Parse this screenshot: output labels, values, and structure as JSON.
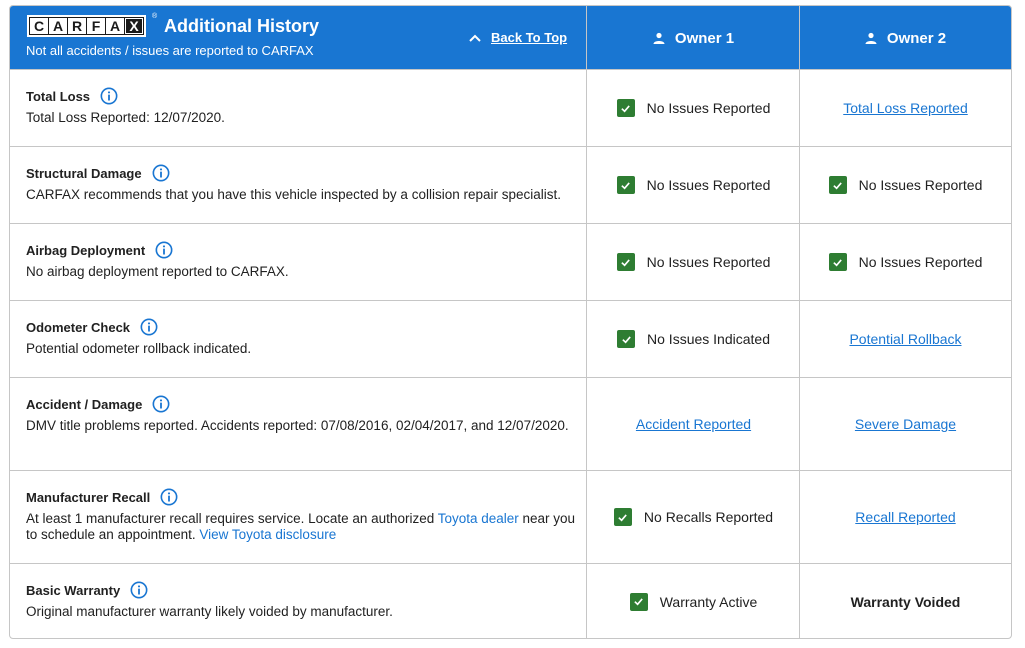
{
  "header": {
    "logo_letters": [
      "C",
      "A",
      "R",
      "F",
      "A",
      "X"
    ],
    "logo_reg": "®",
    "title": "Additional History",
    "subtitle": "Not all accidents / issues are reported to CARFAX",
    "back_to_top": "Back To Top",
    "owners": [
      "Owner 1",
      "Owner 2"
    ]
  },
  "colors": {
    "header_bg": "#1976d2",
    "check_green": "#2e7d32",
    "link_blue": "#1976d2",
    "border": "#c6c6c6"
  },
  "rows": [
    {
      "title": "Total Loss",
      "description": "Total Loss Reported: 12/07/2020.",
      "owner1": {
        "type": "check",
        "text": "No Issues Reported"
      },
      "owner2": {
        "type": "link",
        "text": "Total Loss Reported"
      }
    },
    {
      "title": "Structural Damage",
      "description": "CARFAX recommends that you have this vehicle inspected by a collision repair specialist.",
      "owner1": {
        "type": "check",
        "text": "No Issues Reported"
      },
      "owner2": {
        "type": "check",
        "text": "No Issues Reported"
      }
    },
    {
      "title": "Airbag Deployment",
      "description": "No airbag deployment reported to CARFAX.",
      "owner1": {
        "type": "check",
        "text": "No Issues Reported"
      },
      "owner2": {
        "type": "check",
        "text": "No Issues Reported"
      }
    },
    {
      "title": "Odometer Check",
      "description": "Potential odometer rollback indicated.",
      "owner1": {
        "type": "check",
        "text": "No Issues Indicated"
      },
      "owner2": {
        "type": "link",
        "text": "Potential Rollback"
      }
    },
    {
      "title": "Accident / Damage",
      "description": "DMV title problems reported. Accidents reported: 07/08/2016, 02/04/2017, and 12/07/2020.",
      "owner1": {
        "type": "link",
        "text": "Accident Reported"
      },
      "owner2": {
        "type": "link",
        "text": "Severe Damage"
      }
    },
    {
      "title": "Manufacturer Recall",
      "description_parts": {
        "before": "At least 1 manufacturer recall requires service. Locate an authorized ",
        "dealer_link": "Toyota dealer",
        "after": " near you to schedule an appointment. ",
        "disclosure_link": "View Toyota disclosure"
      },
      "owner1": {
        "type": "check",
        "text": "No Recalls Reported"
      },
      "owner2": {
        "type": "link",
        "text": "Recall Reported"
      }
    },
    {
      "title": "Basic Warranty",
      "description": "Original manufacturer warranty likely voided by manufacturer.",
      "owner1": {
        "type": "check",
        "text": "Warranty Active"
      },
      "owner2": {
        "type": "bold",
        "text": "Warranty Voided"
      }
    }
  ]
}
